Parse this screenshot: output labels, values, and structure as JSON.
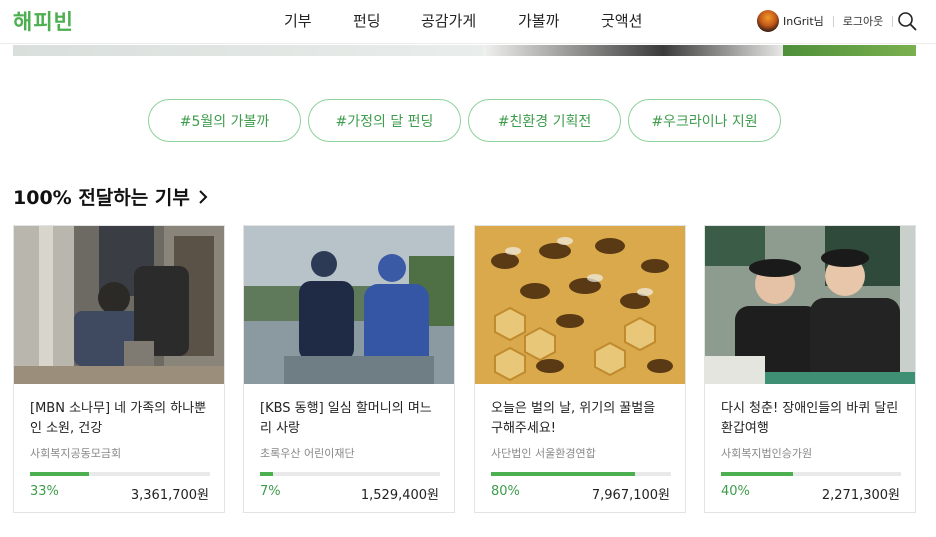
{
  "header": {
    "logo": "해피빈",
    "nav": [
      "기부",
      "펀딩",
      "공감가게",
      "가볼까",
      "굿액션"
    ],
    "user_name": "InGrit님",
    "logout": "로그아웃",
    "search_icon": "search-icon"
  },
  "hashtags": [
    "#5월의 가볼까",
    "#가정의 달 펀딩",
    "#친환경 기획전",
    "#우크라이나 지원"
  ],
  "section": {
    "title": "100% 전달하는 기부",
    "icon": "chevron-right-icon"
  },
  "cards": [
    {
      "title": "[MBN 소나무] 네 가족의 하나뿐인 소원, 건강",
      "org": "사회복지공동모금회",
      "percent_label": "33%",
      "progress": 0.33,
      "amount": "3,361,700원",
      "image": "family-room-photo"
    },
    {
      "title": "[KBS 동행] 일심 할머니의 며느리 사랑",
      "org": "초록우산 어린이재단",
      "percent_label": "7%",
      "progress": 0.07,
      "amount": "1,529,400원",
      "image": "rain-coat-women-photo"
    },
    {
      "title": "오늘은 벌의 날, 위기의 꿀벌을 구해주세요!",
      "org": "사단법인 서울환경연합",
      "percent_label": "80%",
      "progress": 0.8,
      "amount": "7,967,100원",
      "image": "honeybees-photo"
    },
    {
      "title": "다시 청춘! 장애인들의 바퀴 달린 환갑여행",
      "org": "사회복지법인승가원",
      "percent_label": "40%",
      "progress": 0.4,
      "amount": "2,271,300원",
      "image": "two-smiling-people-photo"
    }
  ],
  "colors": {
    "brand_green": "#4caf50",
    "tag_border": "#8fd19a",
    "text_green": "#3f9c4d"
  }
}
